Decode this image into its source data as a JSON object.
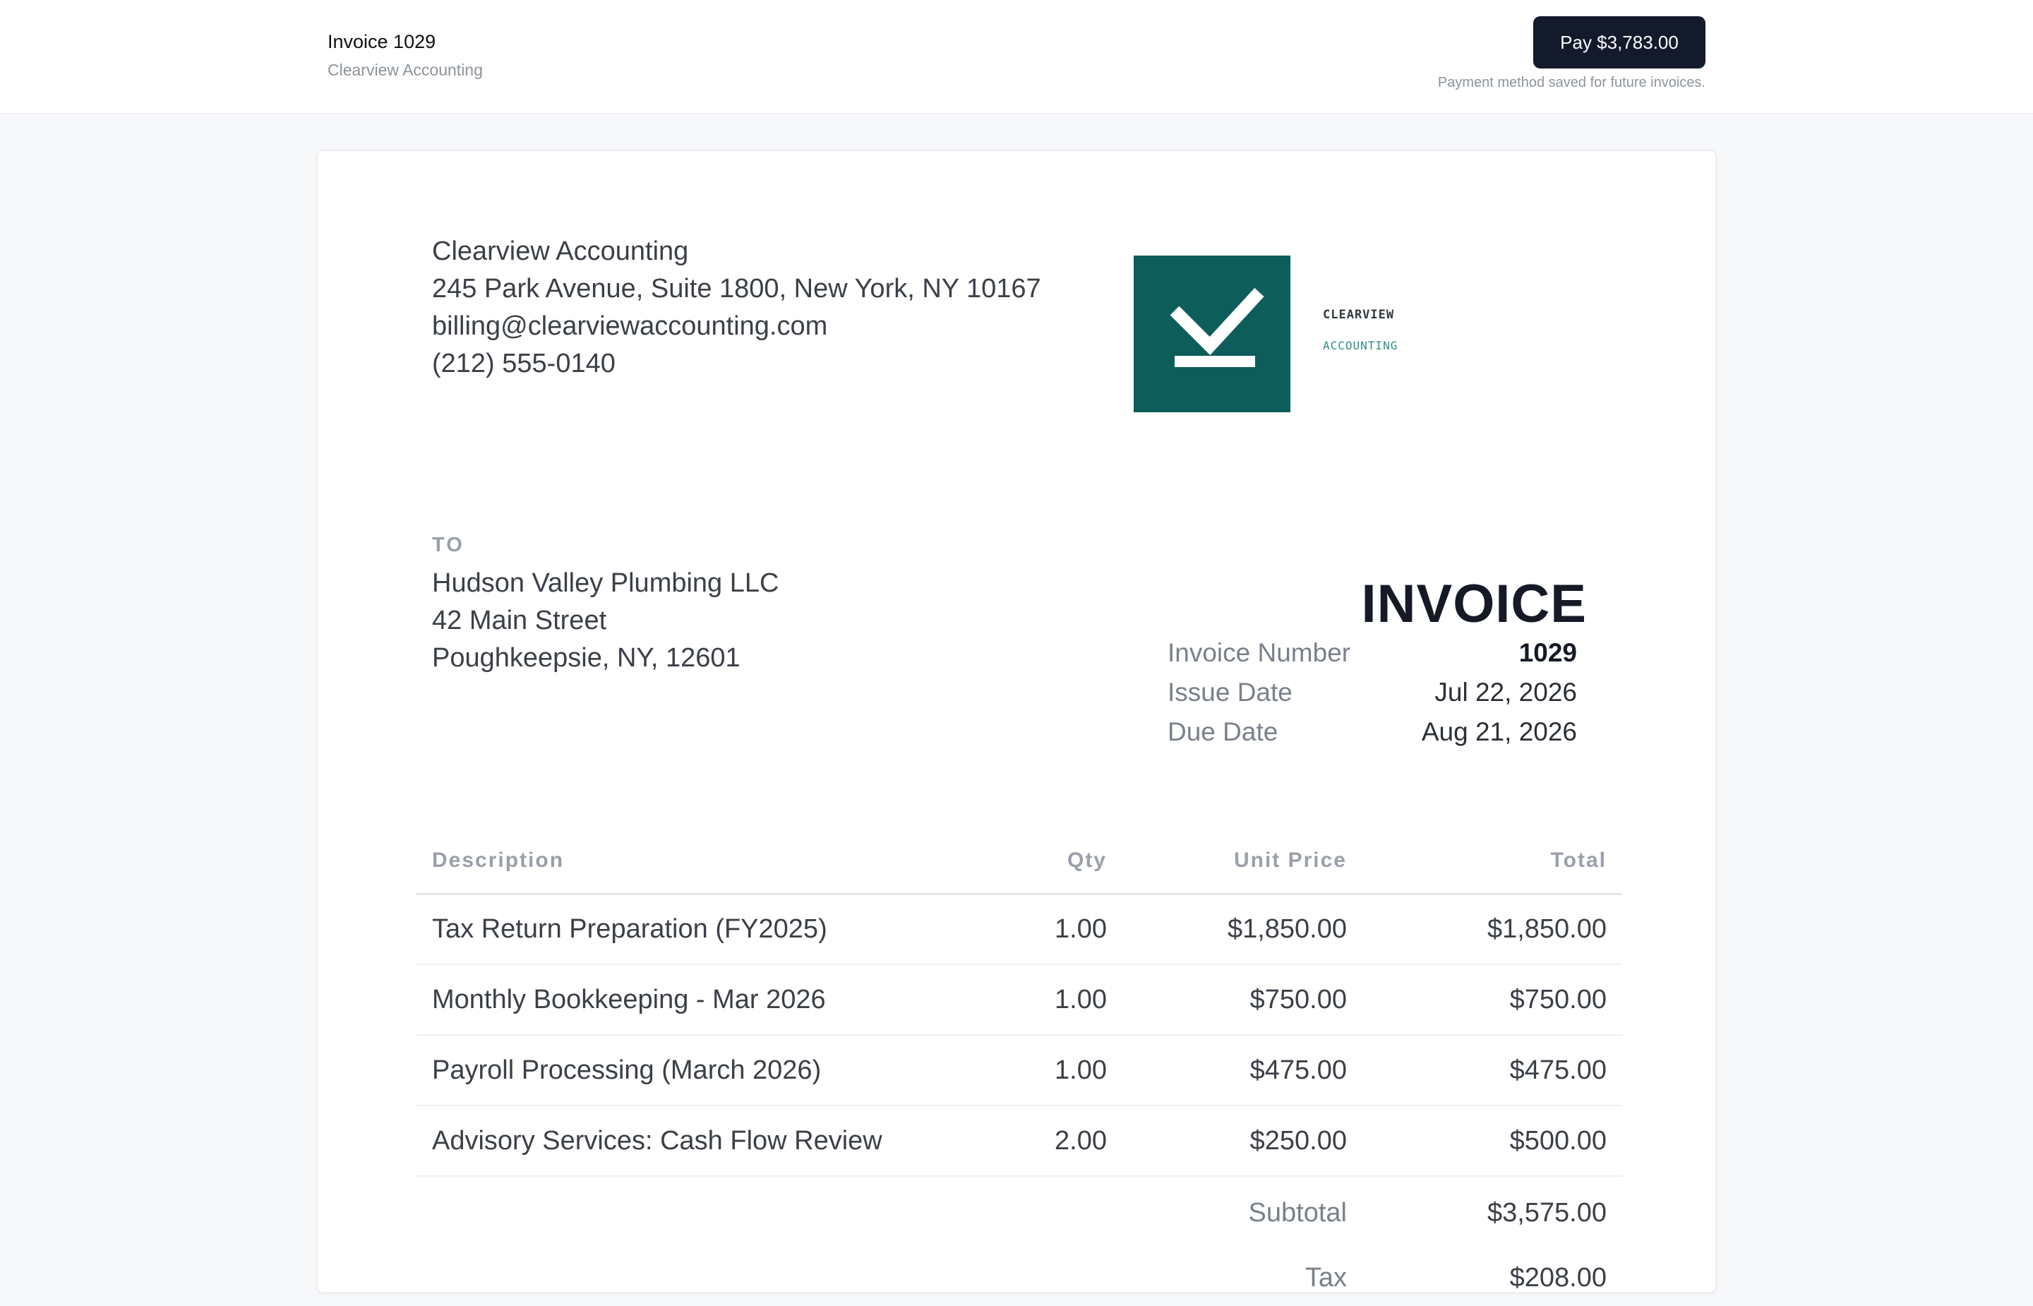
{
  "header": {
    "title": "Invoice 1029",
    "subtitle": "Clearview Accounting",
    "pay_button": "Pay $3,783.00",
    "saved_note": "Payment method saved for future invoices."
  },
  "from": {
    "name": "Clearview Accounting",
    "address": "245 Park Avenue, Suite 1800, New York, NY 10167",
    "email": "billing@clearviewaccounting.com",
    "phone": "(212) 555-0140"
  },
  "logo": {
    "icon": "checkmark-icon",
    "color": "#0d5e5a",
    "wordmark": "CLEARVIEW",
    "wordmark_sub": "ACCOUNTING"
  },
  "to": {
    "label": "TO",
    "name": "Hudson Valley Plumbing LLC",
    "street": "42 Main Street",
    "city": "Poughkeepsie, NY, 12601"
  },
  "invoice": {
    "heading": "INVOICE",
    "number_label": "Invoice Number",
    "number": "1029",
    "issue_label": "Issue Date",
    "issue_date": "Jul 22, 2026",
    "due_label": "Due Date",
    "due_date": "Aug 21, 2026"
  },
  "table": {
    "headers": {
      "description": "Description",
      "qty": "Qty",
      "unit_price": "Unit Price",
      "total": "Total"
    },
    "rows": [
      {
        "description": "Tax Return Preparation (FY2025)",
        "qty": "1.00",
        "unit_price": "$1,850.00",
        "total": "$1,850.00"
      },
      {
        "description": "Monthly Bookkeeping - Mar 2026",
        "qty": "1.00",
        "unit_price": "$750.00",
        "total": "$750.00"
      },
      {
        "description": "Payroll Processing (March 2026)",
        "qty": "1.00",
        "unit_price": "$475.00",
        "total": "$475.00"
      },
      {
        "description": "Advisory Services: Cash Flow Review",
        "qty": "2.00",
        "unit_price": "$250.00",
        "total": "$500.00"
      }
    ],
    "subtotal_label": "Subtotal",
    "subtotal": "$3,575.00",
    "tax_label": "Tax",
    "tax": "$208.00"
  }
}
